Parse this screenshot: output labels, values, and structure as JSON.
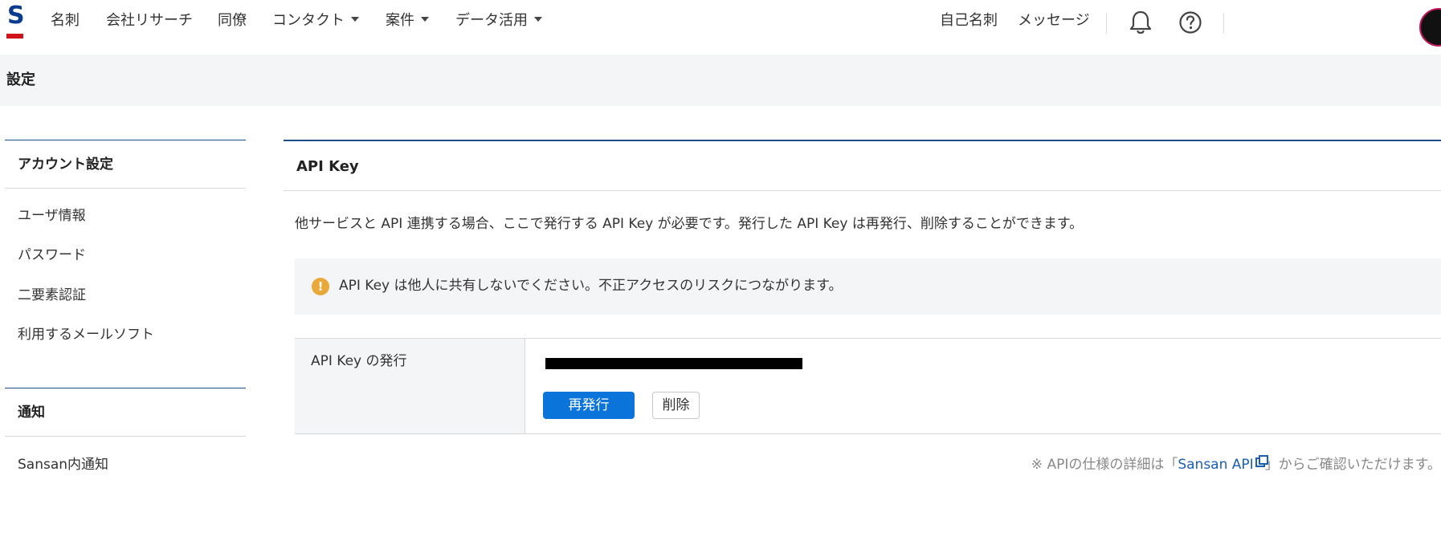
{
  "nav": {
    "logo": "S",
    "items": [
      {
        "label": "名刺",
        "dropdown": false
      },
      {
        "label": "会社リサーチ",
        "dropdown": false
      },
      {
        "label": "同僚",
        "dropdown": false
      },
      {
        "label": "コンタクト",
        "dropdown": true
      },
      {
        "label": "案件",
        "dropdown": true
      },
      {
        "label": "データ活用",
        "dropdown": true
      }
    ],
    "right": {
      "my_card": "自己名刺",
      "messages": "メッセージ"
    },
    "icons": [
      "bell-icon",
      "help-circle-icon"
    ]
  },
  "page": {
    "title": "設定"
  },
  "sidebar": {
    "sections": [
      {
        "title": "アカウント設定",
        "items": [
          "ユーザ情報",
          "パスワード",
          "二要素認証",
          "利用するメールソフト"
        ]
      },
      {
        "title": "通知",
        "items": [
          "Sansan内通知"
        ]
      }
    ]
  },
  "main": {
    "card_title": "API Key",
    "description": "他サービスと API 連携する場合、ここで発行する API Key が必要です。発行した API Key は再発行、削除することができます。",
    "warning": "API Key は他人に共有しないでください。不正アクセスのリスクにつながります。",
    "row_label": "API Key の発行",
    "reissue_button": "再発行",
    "delete_button": "削除",
    "footnote_prefix": "※ APIの仕様の詳細は「",
    "footnote_link": "Sansan API",
    "footnote_suffix": "」からご確認いただけます。"
  },
  "colors": {
    "brand_blue": "#0b3a8f",
    "brand_red": "#d0121b",
    "primary_button": "#0a74da",
    "warning": "#e9a93a",
    "link": "#1a5fb4"
  }
}
